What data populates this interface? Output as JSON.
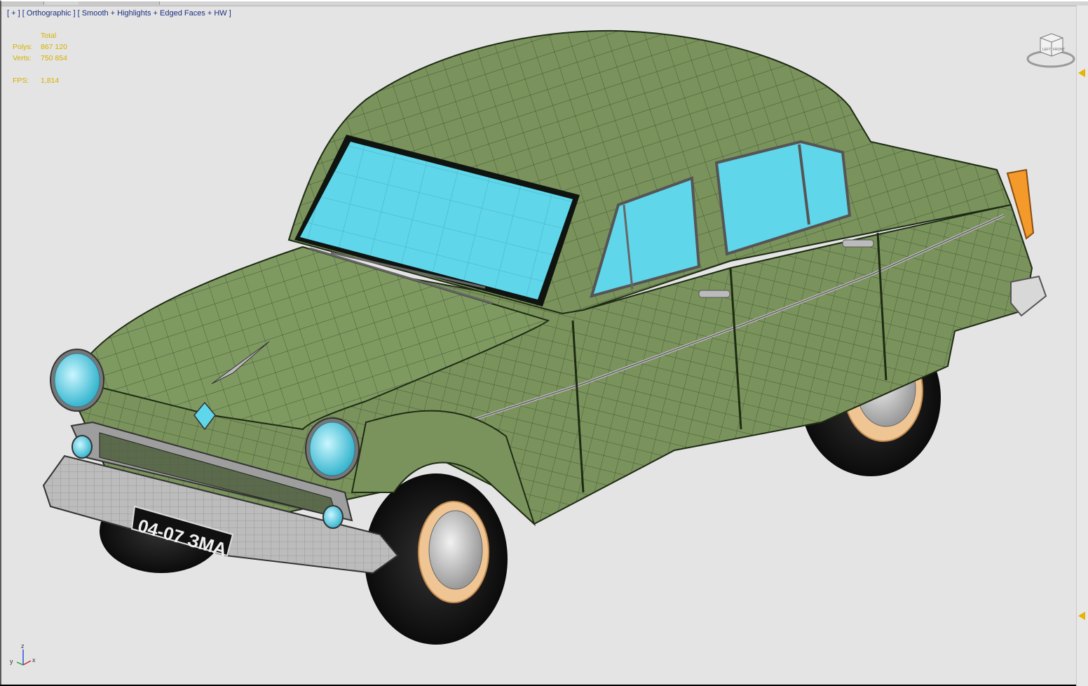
{
  "viewport": {
    "label_parts": [
      "[ + ]",
      "[ Orthographic ]",
      "[ Smooth + Highlights + Edged Faces + HW ]"
    ]
  },
  "stats": {
    "header": "Total",
    "polys_label": "Polys:",
    "polys_value": "867 120",
    "verts_label": "Verts:",
    "verts_value": "750 854",
    "fps_label": "FPS:",
    "fps_value": "1,814"
  },
  "viewcube": {
    "left_face": "LEFT",
    "front_face": "FRONT"
  },
  "model": {
    "license_plate": "04-07 ЗМА",
    "body_color": "#7a935c",
    "glass_color": "#5fd6ea",
    "rim_color": "#f0c594",
    "tire_color": "#111111"
  },
  "axis_tripod": {
    "x_label": "x",
    "y_label": "y",
    "z_label": "z"
  },
  "colors": {
    "viewport_bg": "#e4e4e4",
    "label_text": "#1a2e80",
    "stats_text": "#d4b000"
  }
}
